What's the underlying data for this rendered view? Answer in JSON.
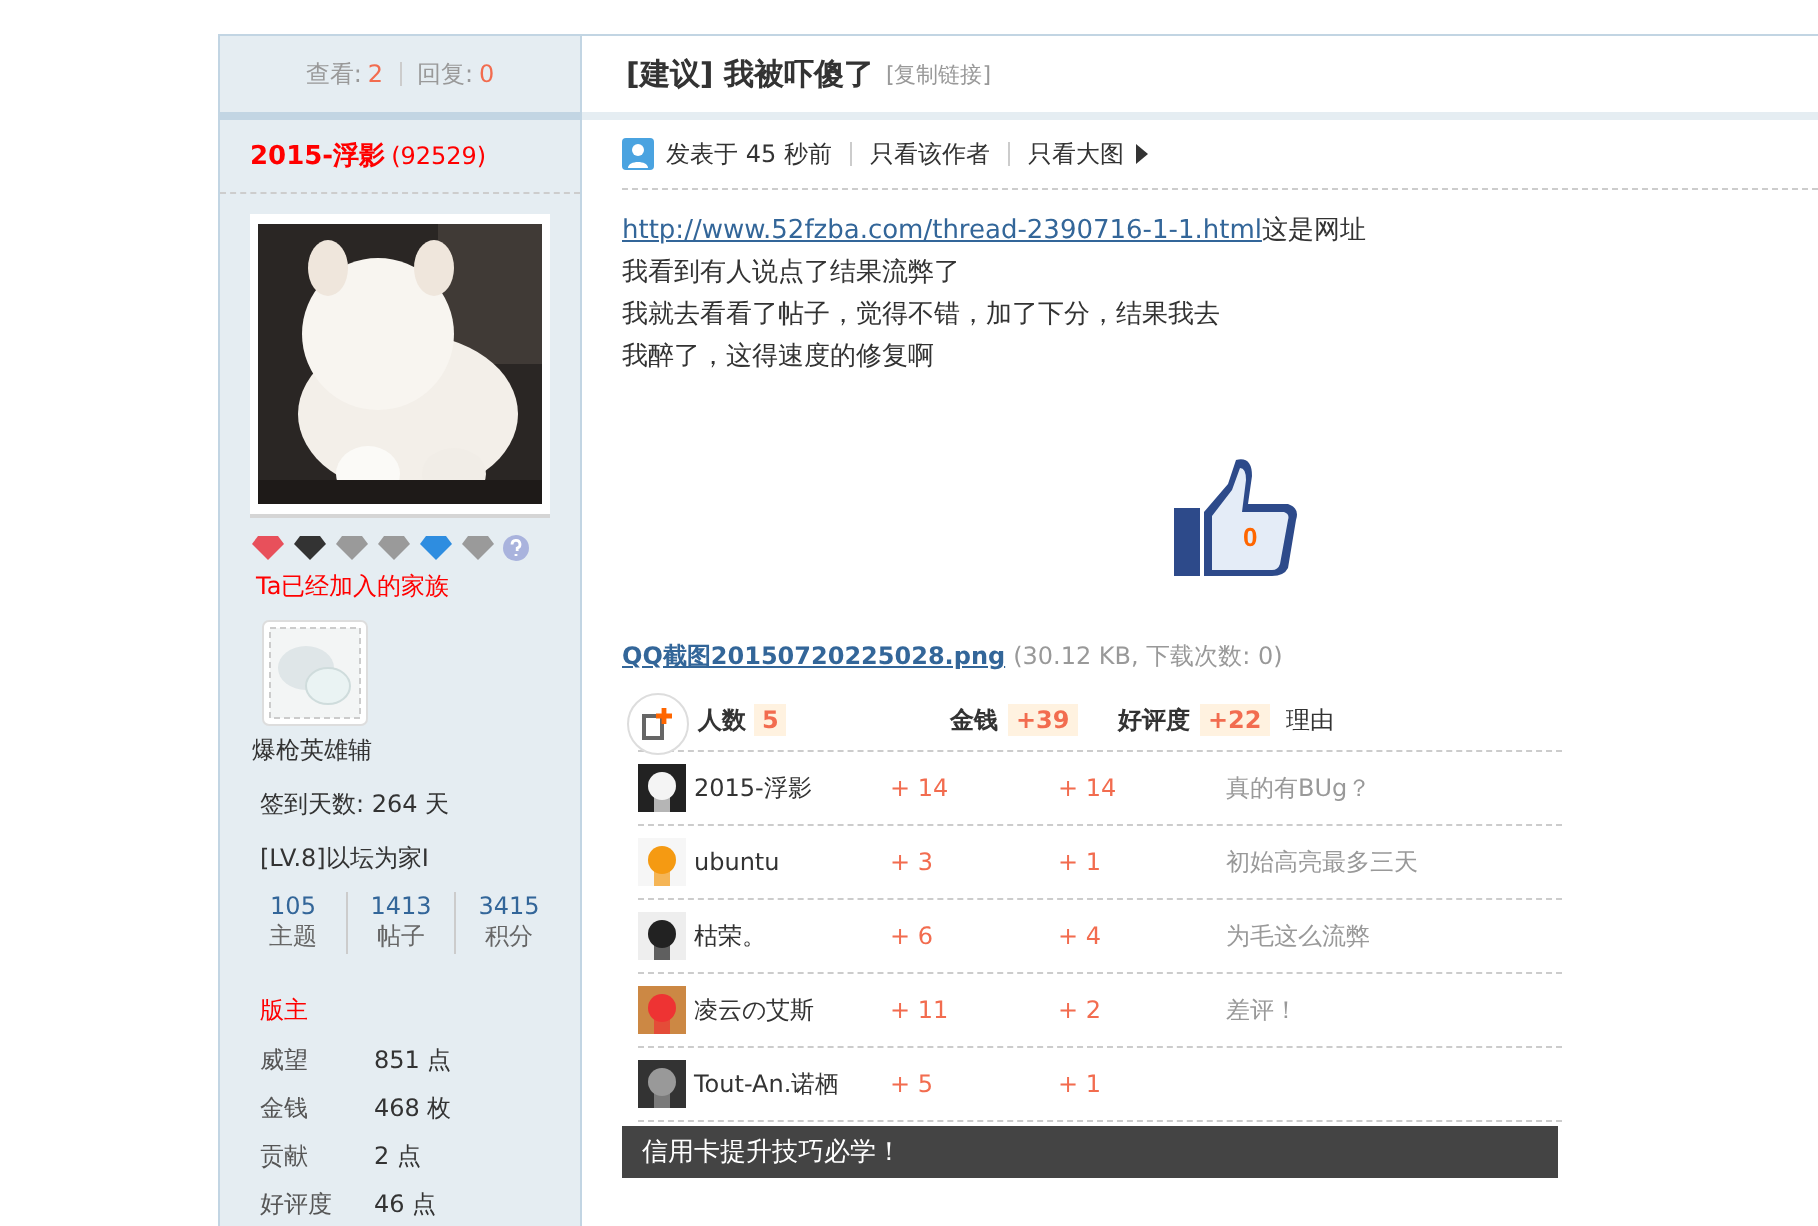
{
  "sidebar": {
    "views_label": "查看:",
    "views": "2",
    "replies_label": "回复:",
    "replies": "0",
    "username": "2015-浮影",
    "uid": "(92529)",
    "medals": [
      {
        "color": "#e8505b"
      },
      {
        "color": "#333333"
      },
      {
        "color": "#9a9a9a"
      },
      {
        "color": "#9a9a9a"
      },
      {
        "color": "#2e8de0"
      },
      {
        "color": "#9a9a9a"
      }
    ],
    "family_heading": "Ta已经加入的家族",
    "family": {
      "name": "爆枪英雄辅"
    },
    "sign_days": "签到天数: 264 天",
    "level": "[LV.8]以坛为家I",
    "stats": [
      {
        "value": "105",
        "label": "主题"
      },
      {
        "value": "1413",
        "label": "帖子"
      },
      {
        "value": "3415",
        "label": "积分"
      }
    ],
    "group": "版主",
    "attributes": [
      {
        "label": "威望",
        "value": "851 点"
      },
      {
        "label": "金钱",
        "value": "468 枚"
      },
      {
        "label": "贡献",
        "value": "2 点"
      },
      {
        "label": "好评度",
        "value": "46 点"
      }
    ]
  },
  "post": {
    "tag": "[建议]",
    "title": "我被吓傻了",
    "copy_link": "[复制链接]",
    "posted": "发表于 45 秒前",
    "author_only": "只看该作者",
    "big_images": "只看大图",
    "link": "http://www.52fzba.com/thread-2390716-1-1.html",
    "link_suffix": "这是网址",
    "lines": [
      "我看到有人说点了结果流弊了",
      "我就去看看了帖子，觉得不错，加了下分，结果我去",
      "我醉了，这得速度的修复啊"
    ],
    "like_count": "0",
    "attachment": {
      "name": "QQ截图20150720225028.png",
      "info": "(30.12 KB, 下载次数: 0)"
    },
    "rating": {
      "people_label": "人数",
      "people": "5",
      "money_label": "金钱",
      "money": "+39",
      "rep_label": "好评度",
      "rep": "+22",
      "reason_label": "理由",
      "rows": [
        {
          "user": "2015-浮影",
          "money": "+ 14",
          "rep": "+ 14",
          "reason": "真的有BUg？"
        },
        {
          "user": "ubuntu",
          "money": "+ 3",
          "rep": "+ 1",
          "reason": "初始高亮最多三天"
        },
        {
          "user": "枯荣。",
          "money": "+ 6",
          "rep": "+ 4",
          "reason": "为毛这么流弊"
        },
        {
          "user": "凌云の艾斯",
          "money": "+ 11",
          "rep": "+ 2",
          "reason": "差评！"
        },
        {
          "user": "Tout-An.诺栖",
          "money": "+ 5",
          "rep": "+ 1"
        }
      ]
    },
    "ad": "信用卡提升技巧必学！"
  }
}
